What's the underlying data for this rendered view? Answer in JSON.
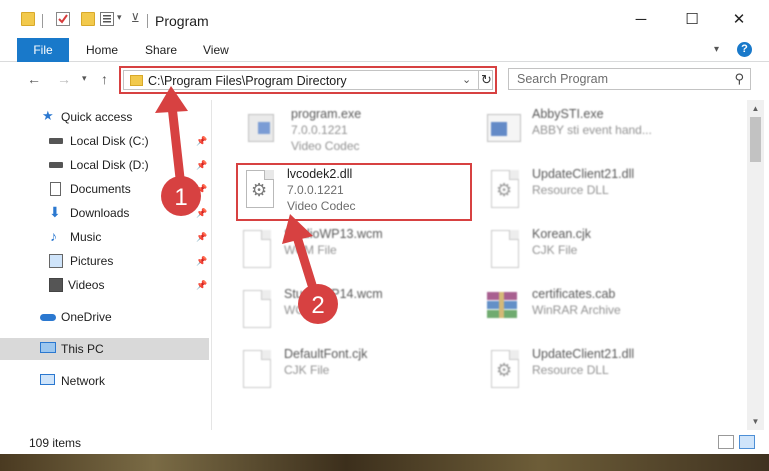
{
  "window": {
    "title": "Program",
    "controls": {
      "minimize": "─",
      "maximize": "☐",
      "close": "✕"
    }
  },
  "ribbon": {
    "tabs": [
      {
        "label": "File"
      },
      {
        "label": "Home"
      },
      {
        "label": "Share"
      },
      {
        "label": "View"
      }
    ],
    "help": "?"
  },
  "navigation": {
    "address": "C:\\Program Files\\Program Directory",
    "search_placeholder": "Search Program"
  },
  "sidebar": {
    "quick_access": "Quick access",
    "items": [
      {
        "label": "Local Disk (C:)",
        "icon": "drive-icon",
        "pinned": true
      },
      {
        "label": "Local Disk (D:)",
        "icon": "drive-icon",
        "pinned": true
      },
      {
        "label": "Documents",
        "icon": "documents-icon",
        "pinned": true
      },
      {
        "label": "Downloads",
        "icon": "downloads-icon",
        "pinned": true
      },
      {
        "label": "Music",
        "icon": "music-icon",
        "pinned": true
      },
      {
        "label": "Pictures",
        "icon": "pictures-icon",
        "pinned": true
      },
      {
        "label": "Videos",
        "icon": "videos-icon",
        "pinned": true
      }
    ],
    "onedrive": "OneDrive",
    "this_pc": "This PC",
    "network": "Network"
  },
  "files": [
    {
      "name": "program.exe",
      "line2": "7.0.0.1221",
      "line3": "Video Codec",
      "icon": "exe-icon",
      "blurred": true
    },
    {
      "name": "AbbySTI.exe",
      "line2": "ABBY sti event hand...",
      "icon": "exe-icon",
      "blurred": true
    },
    {
      "name": "lvcodek2.dll",
      "line2": "7.0.0.1221",
      "line3": "Video Codec",
      "icon": "dll-gear-icon",
      "blurred": false
    },
    {
      "name": "UpdateClient21.dll",
      "line2": "Resource DLL",
      "icon": "dll-gear-icon",
      "blurred": true
    },
    {
      "name": "StudioWP13.wcm",
      "line2": "WCM File",
      "icon": "blank-file-icon",
      "blurred": true
    },
    {
      "name": "Korean.cjk",
      "line2": "CJK File",
      "icon": "blank-file-icon",
      "blurred": true
    },
    {
      "name": "StudioWP14.wcm",
      "line2": "WCM File",
      "icon": "blank-file-icon",
      "blurred": true
    },
    {
      "name": "certificates.cab",
      "line2": "WinRAR Archive",
      "icon": "winrar-icon",
      "blurred": true
    },
    {
      "name": "DefaultFont.cjk",
      "line2": "CJK File",
      "icon": "blank-file-icon",
      "blurred": true
    },
    {
      "name": "UpdateClient21.dll",
      "line2": "Resource DLL",
      "icon": "dll-gear-icon",
      "blurred": true
    }
  ],
  "status": {
    "item_count": "109 items"
  },
  "annotations": {
    "step1": "1",
    "step2": "2",
    "color": "#d74141"
  },
  "colors": {
    "accent": "#1979ca",
    "highlight": "#d74141",
    "selected_nav": "#d9d9d9"
  }
}
